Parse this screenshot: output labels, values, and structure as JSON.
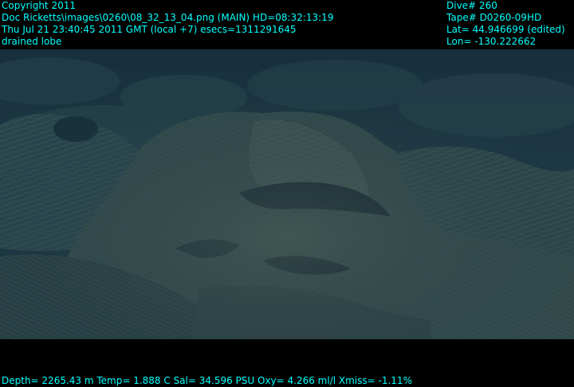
{
  "header_left": {
    "copyright": "Copyright 2011",
    "image_info": "Doc Ricketts\\images\\0260\\08_32_13_04.png (MAIN)  HD=08:32:13:19",
    "datetime": "Thu Jul 21 23:40:45 2011 GMT (local +7)  esecs=1311291645",
    "caption": "drained lobe"
  },
  "header_right": {
    "dive": "Dive# 260",
    "tape": "Tape# D0260-09HD",
    "lat": "Lat= 44.946699 (edited)",
    "lon": "Lon= -130.222662"
  },
  "footer": {
    "sensors": "Depth= 2265.43 m  Temp= 1.888 C  Sal= 34.596 PSU  Oxy= 4.266 ml/l  Xmiss= -1.11%"
  },
  "colors": {
    "overlay_text": "#00ffff",
    "background": "#000000",
    "water": "#1e3a48",
    "rock": "#3e5650"
  },
  "scene": "seafloor-lava-rock-photo"
}
